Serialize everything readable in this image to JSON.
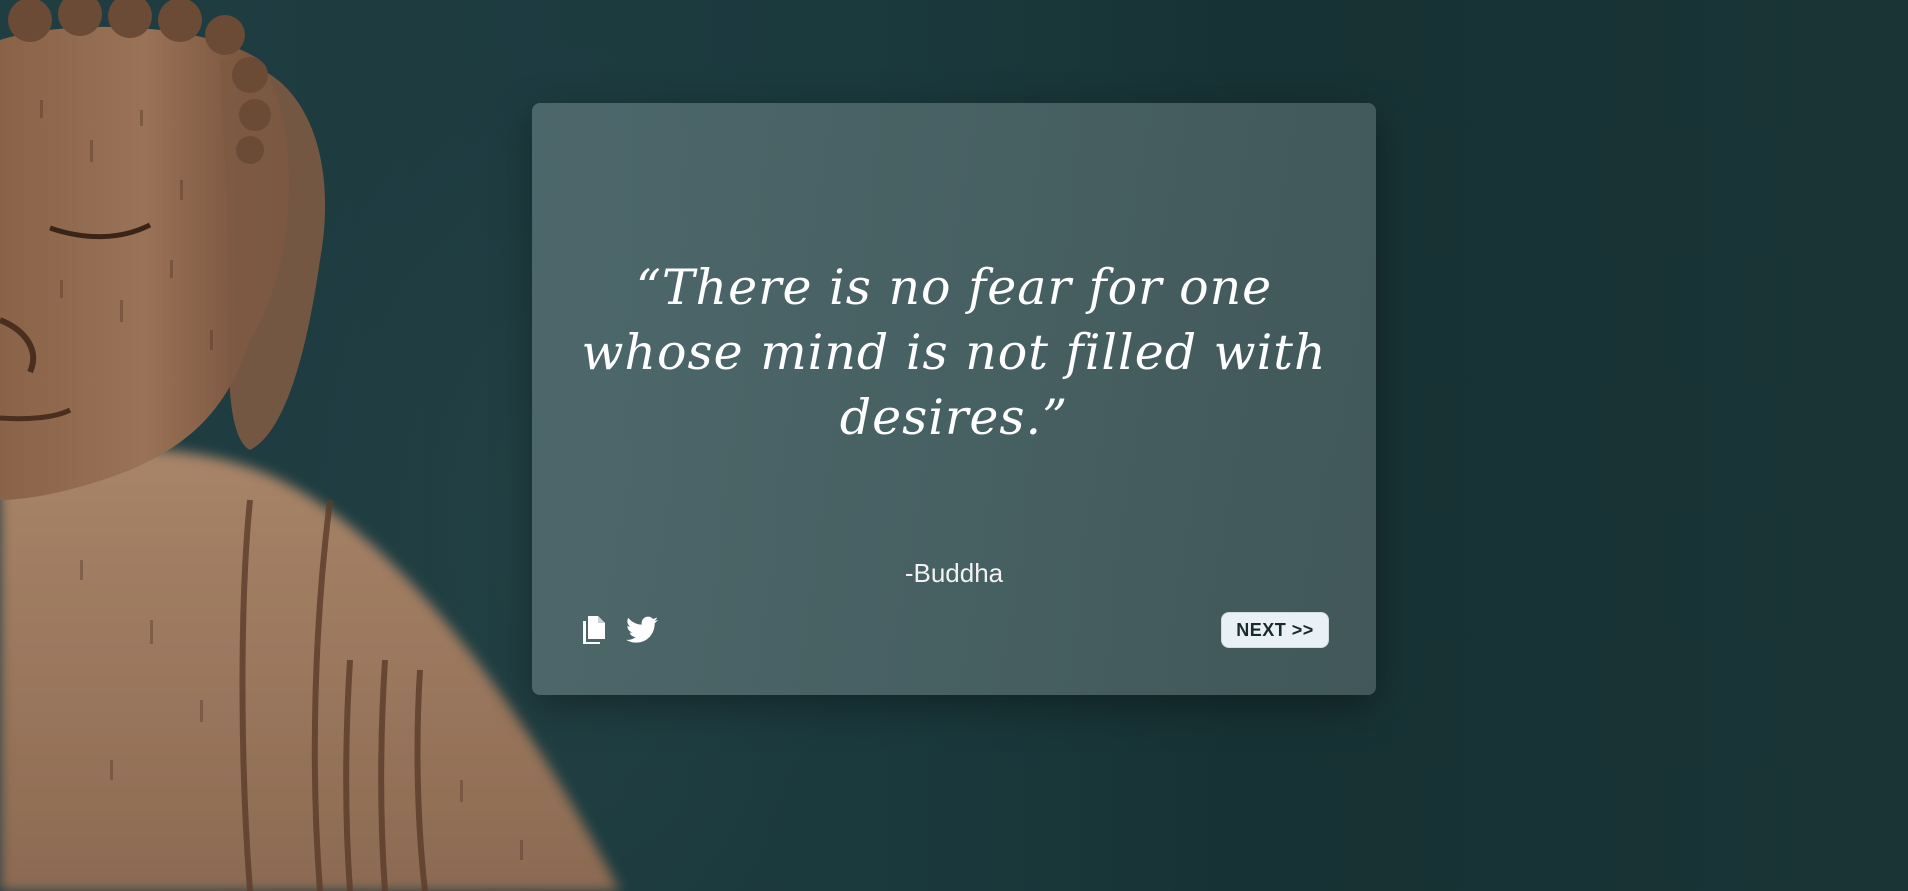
{
  "quote_card": {
    "quote_text": "“There is no fear for one whose mind is not filled with desires.”",
    "author": "-Buddha",
    "next_button_label": "NEXT >>"
  },
  "icons": {
    "copy": "copy-icon",
    "twitter": "twitter-icon"
  },
  "colors": {
    "background": "#1b3a3e",
    "card": "#546e72",
    "button": "#eaf1f6",
    "text": "#ffffff"
  }
}
